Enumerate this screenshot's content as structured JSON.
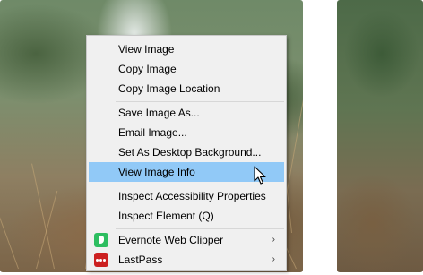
{
  "context_menu": {
    "items": [
      {
        "label": "View Image",
        "hover": false
      },
      {
        "label": "Copy Image",
        "hover": false
      },
      {
        "label": "Copy Image Location",
        "hover": false
      },
      {
        "label": "Save Image As...",
        "hover": false
      },
      {
        "label": "Email Image...",
        "hover": false
      },
      {
        "label": "Set As Desktop Background...",
        "hover": false
      },
      {
        "label": "View Image Info",
        "hover": true
      },
      {
        "label": "Inspect Accessibility Properties",
        "hover": false
      },
      {
        "label": "Inspect Element (Q)",
        "hover": false
      },
      {
        "label": "Evernote Web Clipper",
        "hover": false,
        "icon": "evernote-icon",
        "submenu": true
      },
      {
        "label": "LastPass",
        "hover": false,
        "icon": "lastpass-icon",
        "submenu": true
      }
    ],
    "submenu_arrow": "›"
  },
  "colors": {
    "menu_background": "#f0f0f0",
    "hover_highlight": "#91c9f7",
    "evernote_green": "#2dbe60",
    "lastpass_red": "#cc2020"
  }
}
